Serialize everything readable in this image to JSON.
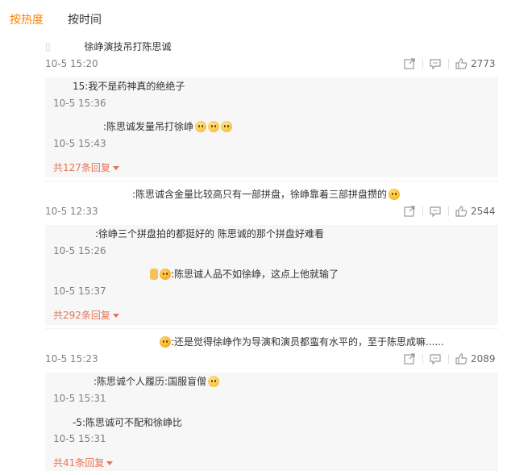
{
  "tabs": {
    "hot": "按热度",
    "time": "按时间"
  },
  "comments": [
    {
      "text": "徐峥演技吊打陈思诚",
      "time": "10-5 15:20",
      "likes": "2773",
      "replies": [
        {
          "text": "15:我不是药神真的绝绝子",
          "time": "10-5 15:36"
        },
        {
          "text": ":陈思诚发量吊打徐峥",
          "time": "10-5 15:43"
        }
      ],
      "more_replies": "共127条回复"
    },
    {
      "text": ":陈思诚含金量比较高只有一部拼盘，徐峥靠着三部拼盘攒的",
      "time": "10-5 12:33",
      "likes": "2544",
      "replies": [
        {
          "text": ":徐峥三个拼盘拍的都挺好的 陈思诚的那个拼盘好难看",
          "time": "10-5 15:26"
        },
        {
          "text": ":陈思诚人品不如徐峥，这点上他就输了",
          "time": "10-5 15:37"
        }
      ],
      "more_replies": "共292条回复"
    },
    {
      "text": ":还是觉得徐峥作为导演和演员都蛮有水平的，至于陈思成嘛......",
      "time": "10-5 15:23",
      "likes": "2089",
      "replies": [
        {
          "text": ":陈思诚个人履历:国服盲僧",
          "time": "10-5 15:31"
        },
        {
          "text": "-5:陈思诚可不配和徐峥比",
          "time": "10-5 15:31"
        }
      ],
      "more_replies": "共41条回复"
    }
  ]
}
